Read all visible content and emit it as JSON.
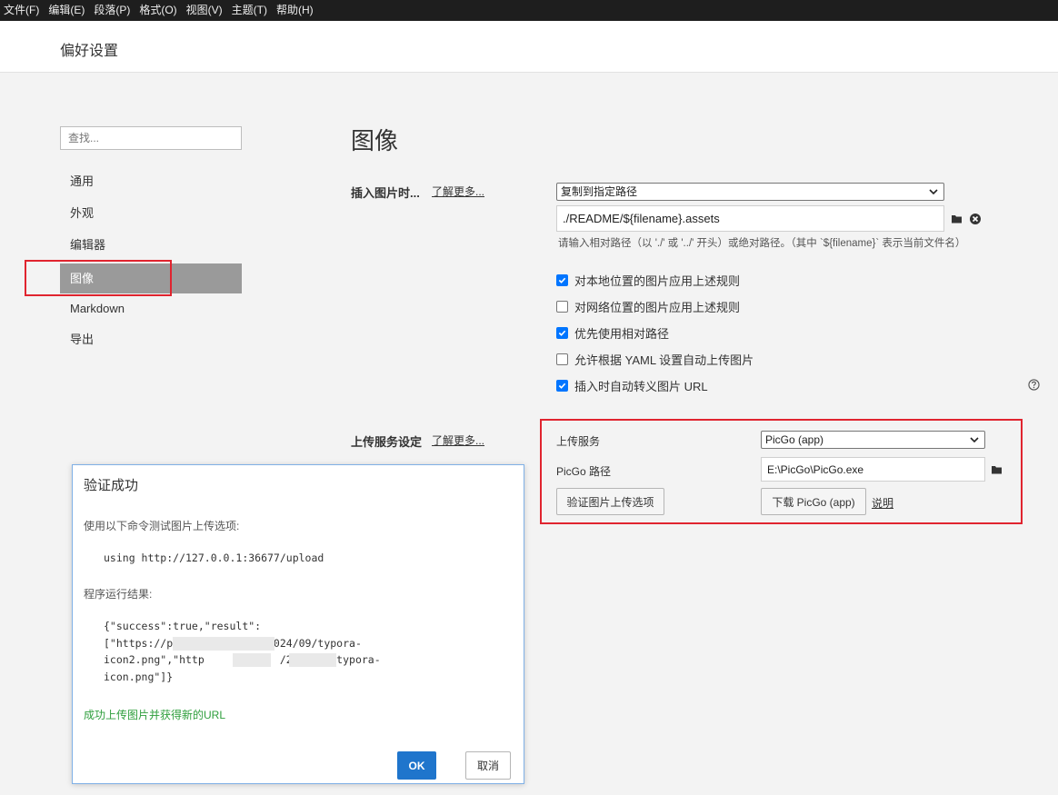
{
  "menubar": {
    "items": [
      {
        "label": "文件(F)"
      },
      {
        "label": "编辑(E)"
      },
      {
        "label": "段落(P)"
      },
      {
        "label": "格式(O)"
      },
      {
        "label": "视图(V)"
      },
      {
        "label": "主题(T)"
      },
      {
        "label": "帮助(H)"
      }
    ]
  },
  "window": {
    "title": "偏好设置"
  },
  "sidebar": {
    "search_placeholder": "查找...",
    "items": [
      {
        "label": "通用"
      },
      {
        "label": "外观"
      },
      {
        "label": "编辑器"
      },
      {
        "label": "图像",
        "active": true
      },
      {
        "label": "Markdown"
      },
      {
        "label": "导出"
      }
    ]
  },
  "main": {
    "section_title": "图像",
    "insert_image": {
      "label": "插入图片时...",
      "learn_more": "了解更多...",
      "action_selected": "复制到指定路径",
      "path_value": "./README/${filename}.assets",
      "hint": "请输入相对路径（以 './' 或 '../' 开头）或绝对路径。（其中 `${filename}` 表示当前文件名）"
    },
    "checkboxes": [
      {
        "label": "对本地位置的图片应用上述规则",
        "checked": true
      },
      {
        "label": "对网络位置的图片应用上述规则",
        "checked": false
      },
      {
        "label": "优先使用相对路径",
        "checked": true
      },
      {
        "label": "允许根据 YAML 设置自动上传图片",
        "checked": false
      },
      {
        "label": "插入时自动转义图片 URL",
        "checked": true
      }
    ],
    "upload": {
      "label": "上传服务设定",
      "learn_more": "了解更多...",
      "service_label": "上传服务",
      "service_selected": "PicGo (app)",
      "path_label": "PicGo 路径",
      "path_value": "E:\\PicGo\\PicGo.exe",
      "verify_button": "验证图片上传选项",
      "download_button": "下载 PicGo (app)",
      "explain_link": "说明"
    }
  },
  "dialog": {
    "title": "验证成功",
    "intro": "使用以下命令测试图片上传选项:",
    "command": "using http://127.0.0.1:36677/upload",
    "result_label": "程序运行结果:",
    "result_lines": [
      "{\"success\":true,\"result\":",
      "[\"https://p            yz/2024/09/typora-",
      "icon2.png\",\"http            /2024/09/typora-",
      "icon.png\"]}"
    ],
    "success": "成功上传图片并获得新的URL",
    "ok": "OK",
    "cancel": "取消"
  },
  "colors": {
    "accent": "#1f75cc",
    "checkbox": "#0075ff",
    "highlight_box": "#e0242f",
    "success_text": "#2e9e3c",
    "active_nav": "#9a9a9a"
  }
}
